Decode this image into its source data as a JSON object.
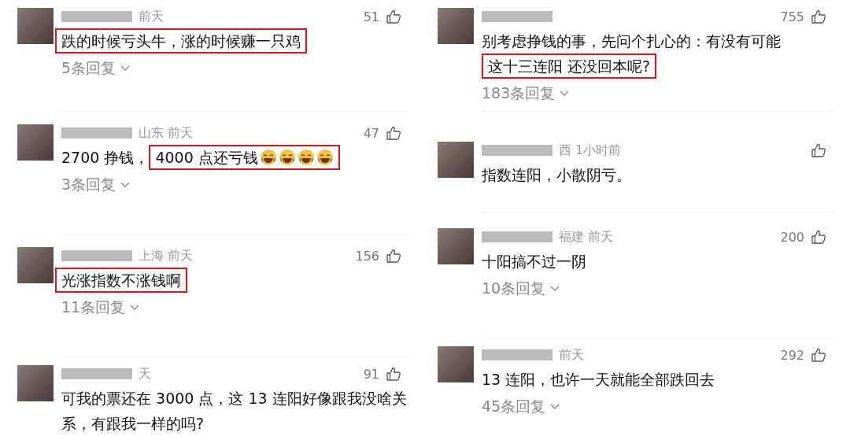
{
  "columns": [
    {
      "comments": [
        {
          "meta": "前天",
          "likes": "51",
          "segments": [
            {
              "text": "跌的时候亏头牛，涨的时候赚一只鸡",
              "highlighted": true
            }
          ],
          "replies": "5条回复"
        },
        {
          "meta": "山东 前天",
          "likes": "47",
          "segments": [
            {
              "text": "2700 挣钱，",
              "highlighted": false
            },
            {
              "text": "4000 点还亏钱",
              "highlighted": true,
              "emojis": [
                {
                  "kind": "laugh-cry"
                },
                {
                  "kind": "laugh-cry"
                },
                {
                  "kind": "laugh-cry"
                },
                {
                  "kind": "laugh-cry"
                }
              ]
            }
          ],
          "replies": "3条回复"
        },
        {
          "meta": "上海 前天",
          "likes": "156",
          "segments": [
            {
              "text": "光涨指数不涨钱啊",
              "highlighted": true
            }
          ],
          "replies": "11条回复"
        },
        {
          "meta": "天",
          "likes": "91",
          "segments": [
            {
              "text": "可我的票还在 3000 点，这 13 连阳好像跟我没啥关系，有跟我一样的吗?",
              "highlighted": false
            }
          ]
        }
      ]
    },
    {
      "comments": [
        {
          "likes": "755",
          "segments": [
            {
              "text": "别考虑挣钱的事，先问个扎心的：有没有可能",
              "highlighted": false
            },
            {
              "text": "这十三连阳 还没回本呢?",
              "highlighted": true
            }
          ],
          "replies": "183条回复"
        },
        {
          "meta": "西 1小时前",
          "segments": [
            {
              "text": "指数连阳，小散阴亏。",
              "highlighted": false
            }
          ]
        },
        {
          "meta": "福建 前天",
          "likes": "200",
          "segments": [
            {
              "text": "十阳搞不过一阴",
              "highlighted": false
            }
          ],
          "replies": "10条回复"
        },
        {
          "meta": "前天",
          "likes": "292",
          "segments": [
            {
              "text": "13 连阳，也许一天就能全部跌回去",
              "highlighted": false
            }
          ],
          "replies": "45条回复"
        }
      ]
    }
  ]
}
